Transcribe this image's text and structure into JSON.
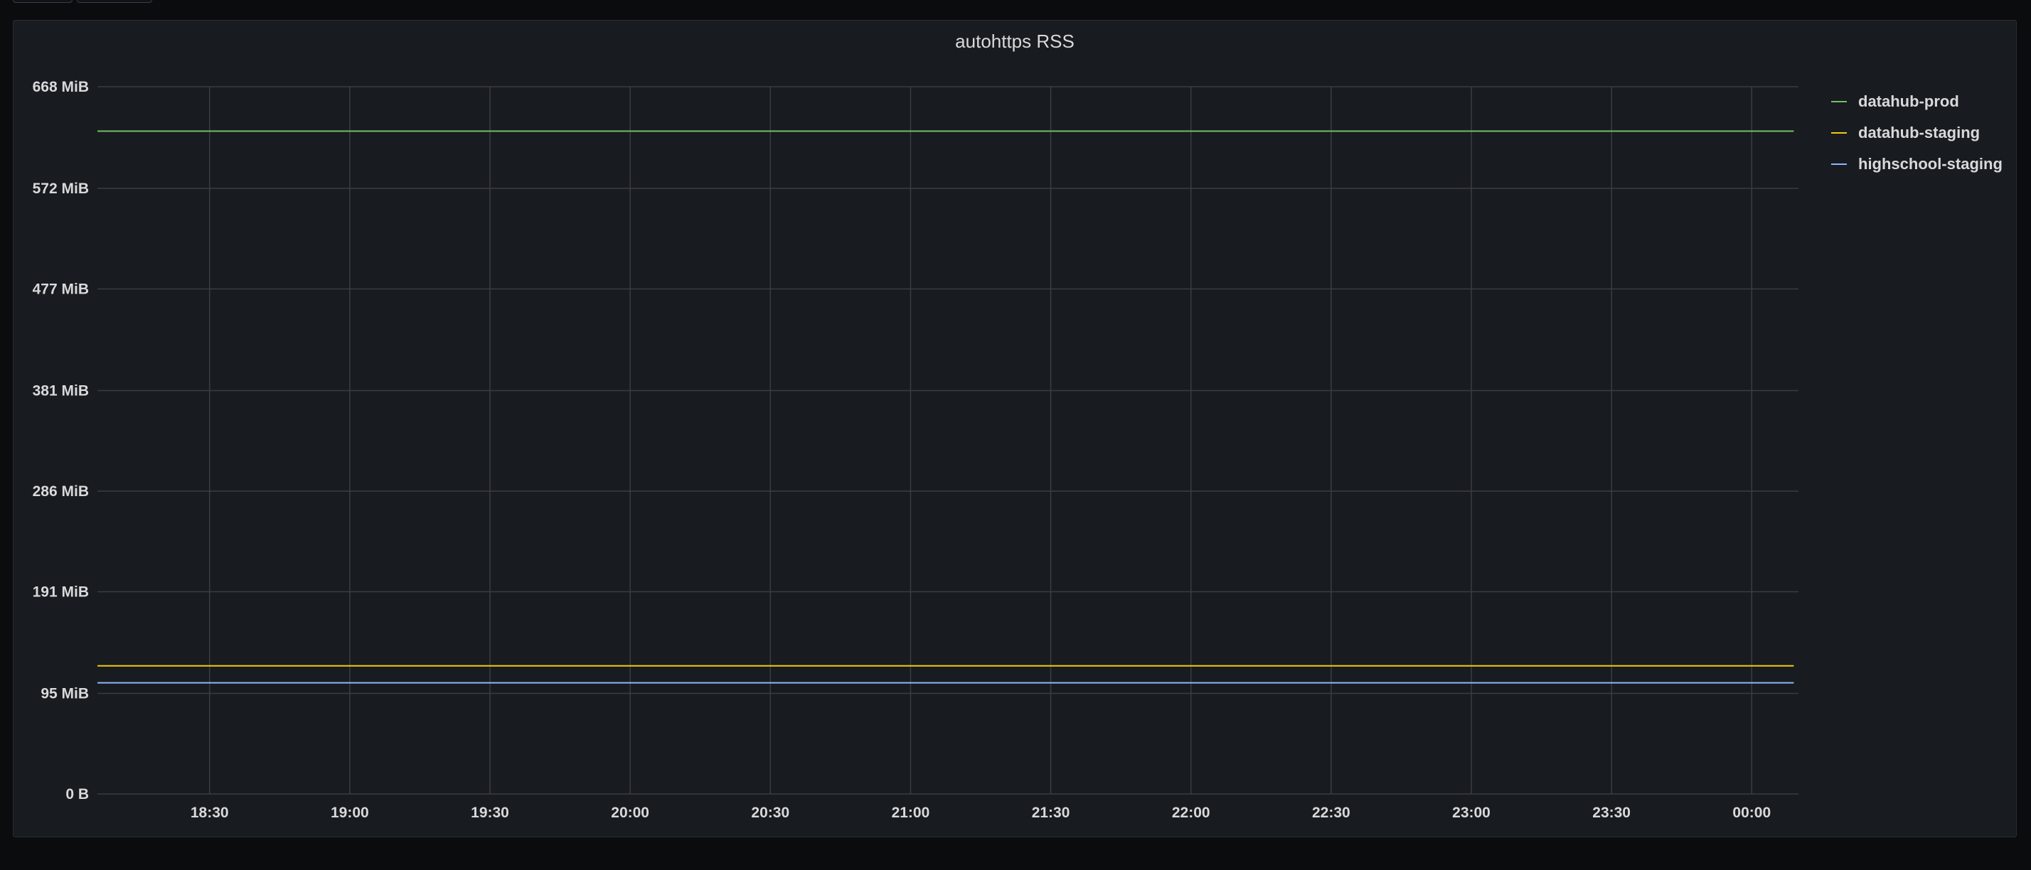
{
  "panel": {
    "title": "autohttps RSS"
  },
  "colors": {
    "datahub-prod": "#73bf69",
    "datahub-staging": "#f2cc0c",
    "highschool-staging": "#8ab8ff",
    "grid": "#3a3d43",
    "axis_text": "#d8d9da"
  },
  "chart_data": {
    "type": "line",
    "title": "autohttps RSS",
    "xlabel": "",
    "ylabel": "",
    "y_unit": "MiB",
    "ylim": [
      0,
      668
    ],
    "yticks": [
      0,
      95,
      191,
      286,
      381,
      477,
      572,
      668
    ],
    "ytick_labels": [
      "0 B",
      "95 MiB",
      "191 MiB",
      "286 MiB",
      "381 MiB",
      "477 MiB",
      "572 MiB",
      "668 MiB"
    ],
    "xlim": [
      "18:06",
      "00:10"
    ],
    "xticks": [
      "18:30",
      "19:00",
      "19:30",
      "20:00",
      "20:30",
      "21:00",
      "21:30",
      "22:00",
      "22:30",
      "23:00",
      "23:30",
      "00:00"
    ],
    "grid": true,
    "legend_position": "right",
    "x": [
      "18:06",
      "00:09"
    ],
    "series": [
      {
        "name": "datahub-prod",
        "values": [
          626,
          626
        ]
      },
      {
        "name": "datahub-staging",
        "values": [
          121,
          121
        ]
      },
      {
        "name": "highschool-staging",
        "values": [
          105,
          105
        ]
      }
    ]
  }
}
